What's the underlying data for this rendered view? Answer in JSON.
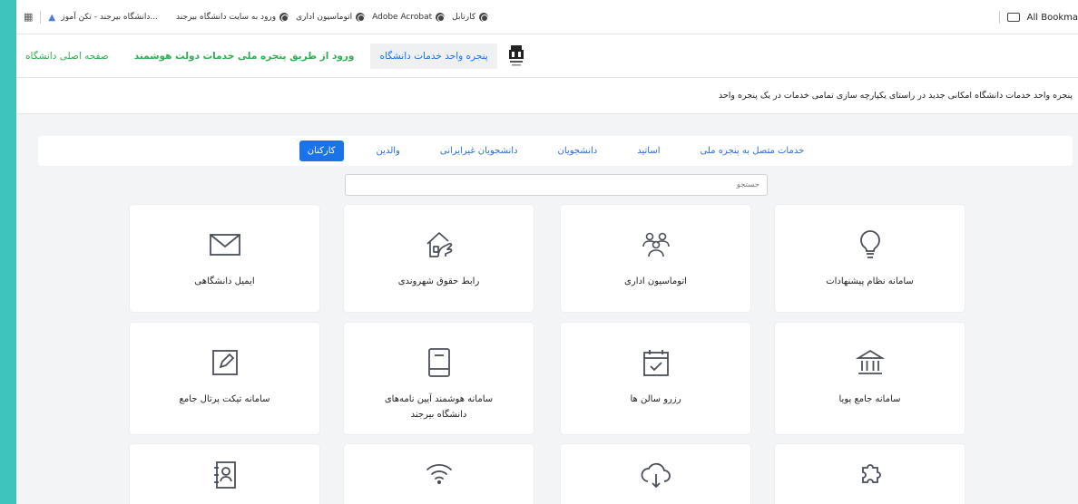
{
  "bookmarks": {
    "items": [
      {
        "label": "دانشگاه بیرجند - تکن آموز...",
        "icon": "drive-icon"
      },
      {
        "label": "ورود به سایت دانشگاه بیرجند",
        "icon": "globe-icon"
      },
      {
        "label": "اتوماسیون اداری",
        "icon": "globe-icon"
      },
      {
        "label": "Adobe Acrobat",
        "icon": "globe-icon"
      },
      {
        "label": "کارتابل",
        "icon": "globe-icon"
      }
    ],
    "all_bookmarks": "All Bookma"
  },
  "nav": {
    "active": "پنجره واحد خدمات دانشگاه",
    "national": "ورود از طریق پنجره ملی خدمات دولت هوشمند",
    "home": "صفحه اصلی دانشگاه"
  },
  "description": "پنجره واحد خدمات دانشگاه امکانی جدید در راستای یکپارچه سازی تمامی خدمات در یک پنجره واحد",
  "tabs": {
    "connected": "خدمات متصل به پنجره ملی",
    "professors": "اساتید",
    "students": "دانشجویان",
    "foreign": "دانشجویان غیرایرانی",
    "parents": "والدین",
    "staff": "کارکنان"
  },
  "search": {
    "placeholder": "جستجو"
  },
  "cards": {
    "suggestions": {
      "label": "سامانه نظام پیشنهادات",
      "icon": "lightbulb-icon"
    },
    "automation": {
      "label": "اتوماسیون اداری",
      "icon": "people-icon"
    },
    "citizenship": {
      "label": "رابط حقوق شهروندی",
      "icon": "home-hand-icon"
    },
    "email": {
      "label": "ایمیل دانشگاهی",
      "icon": "envelope-icon"
    },
    "pooya": {
      "label": "سامانه جامع پویا",
      "icon": "bank-icon"
    },
    "hall": {
      "label": "رزرو سالن ها",
      "icon": "calendar-check-icon"
    },
    "regulations": {
      "label": "سامانه هوشمند آیین نامه‌های دانشگاه بیرجند",
      "icon": "book-icon"
    },
    "ticket": {
      "label": "سامانه تیکت پرتال جامع",
      "icon": "edit-square-icon"
    },
    "row3a": {
      "icon": "puzzle-icon"
    },
    "row3b": {
      "icon": "cloud-download-icon"
    },
    "row3c": {
      "icon": "wifi-icon"
    },
    "row3d": {
      "icon": "contact-book-icon"
    }
  },
  "colors": {
    "accent": "#1a73e8",
    "green": "#2eae4f",
    "background": "#3fc4bd"
  }
}
